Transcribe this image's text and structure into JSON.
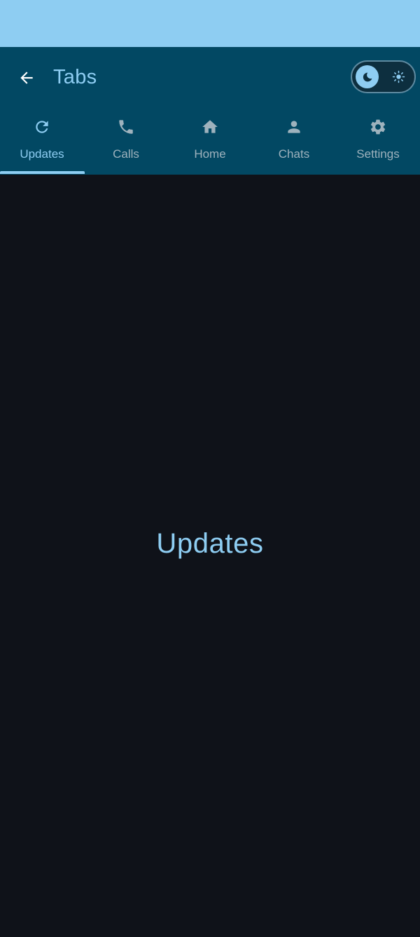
{
  "app_bar": {
    "title": "Tabs",
    "back_icon": "arrow-back-icon",
    "theme_toggle": {
      "state": "dark",
      "knob_icon": "moon-icon",
      "track_icon": "sun-icon"
    }
  },
  "tabs": [
    {
      "label": "Updates",
      "icon": "refresh-icon",
      "active": true
    },
    {
      "label": "Calls",
      "icon": "phone-icon",
      "active": false
    },
    {
      "label": "Home",
      "icon": "home-icon",
      "active": false
    },
    {
      "label": "Chats",
      "icon": "person-icon",
      "active": false
    },
    {
      "label": "Settings",
      "icon": "gear-icon",
      "active": false
    }
  ],
  "content": {
    "text": "Updates"
  },
  "colors": {
    "status_bar": "#8ecdf2",
    "app_bar": "#024863",
    "accent": "#8ecdf2",
    "inactive_tab": "#9eb2bd",
    "background": "#0f1219"
  }
}
